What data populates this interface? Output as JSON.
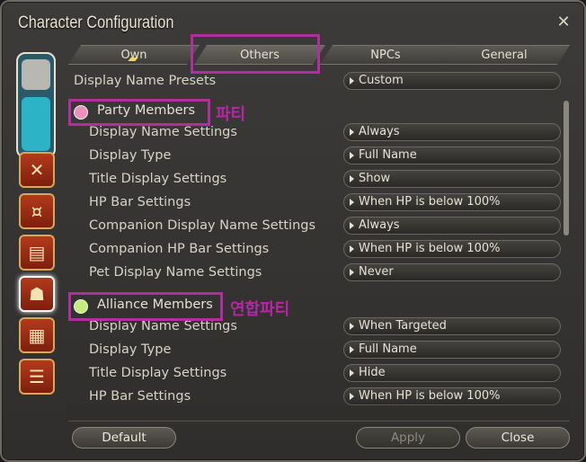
{
  "window": {
    "title": "Character Configuration",
    "close_icon": "close-icon"
  },
  "tabs": [
    {
      "label": "Own"
    },
    {
      "label": "Others"
    },
    {
      "label": "NPCs"
    },
    {
      "label": "General"
    }
  ],
  "presets": {
    "label": "Display Name Presets",
    "value": "Custom"
  },
  "party": {
    "heading": "Party Members",
    "annotation": "파티",
    "dot_color": "#f08fbe",
    "rows": [
      {
        "label": "Display Name Settings",
        "value": "Always"
      },
      {
        "label": "Display Type",
        "value": "Full Name"
      },
      {
        "label": "Title Display Settings",
        "value": "Show"
      },
      {
        "label": "HP Bar Settings",
        "value": "When HP is below 100%"
      },
      {
        "label": "Companion Display Name Settings",
        "value": "Always"
      },
      {
        "label": "Companion HP Bar Settings",
        "value": "When HP is below 100%"
      },
      {
        "label": "Pet Display Name Settings",
        "value": "Never"
      }
    ]
  },
  "alliance": {
    "heading": "Alliance Members",
    "annotation": "연합파티",
    "dot_color": "#c6ec7e",
    "rows": [
      {
        "label": "Display Name Settings",
        "value": "When Targeted"
      },
      {
        "label": "Display Type",
        "value": "Full Name"
      },
      {
        "label": "Title Display Settings",
        "value": "Hide"
      },
      {
        "label": "HP Bar Settings",
        "value": "When HP is below 100%"
      }
    ]
  },
  "buttons": {
    "default": "Default",
    "apply": "Apply",
    "close": "Close"
  },
  "colors": {
    "annotation": "#b826a6",
    "accent": "#f1d56a"
  }
}
